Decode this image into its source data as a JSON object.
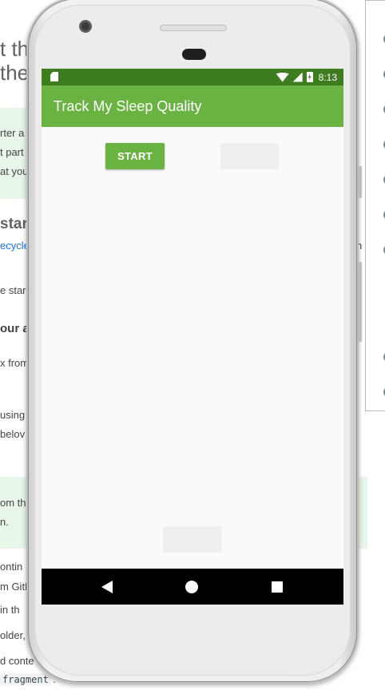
{
  "background_page": {
    "heading_line1": "t th",
    "heading_line2": "the",
    "tip_box_lines": [
      "rter a",
      "t part",
      "at you"
    ],
    "section_heading": "start",
    "link_text": "ecycle",
    "link_right": "n",
    "para1": "e star",
    "subheading": "our a",
    "para2": "x from",
    "para3": "using",
    "para4": "belov",
    "tip_box2_lines": [
      "om th",
      "n."
    ],
    "para5": "ontin",
    "para6": "m GitH",
    "para7": "in th",
    "para8": "older,",
    "para9": "d conte",
    "code_text": "fragment",
    "code_suffix": "."
  },
  "status_bar": {
    "time": "8:13"
  },
  "app_bar": {
    "title": "Track My Sleep Quality"
  },
  "buttons": {
    "start_label": "START",
    "stop_label": "",
    "clear_label": ""
  },
  "sleep_text": ""
}
